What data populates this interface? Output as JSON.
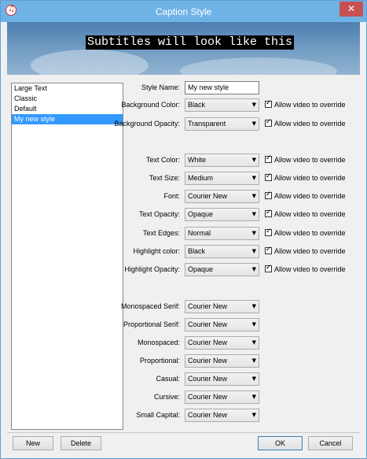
{
  "window": {
    "title": "Caption Style"
  },
  "preview": {
    "text": "Subtitles will look like this"
  },
  "styles": [
    "Large Text",
    "Classic",
    "Default",
    "My new style"
  ],
  "selected_style_index": 3,
  "form": {
    "style_name": {
      "label": "Style Name:",
      "value": "My new style"
    },
    "background_color": {
      "label": "Background Color:",
      "value": "Black",
      "override": "Allow video to override"
    },
    "background_opacity": {
      "label": "Background Opacity:",
      "value": "Transparent",
      "override": "Allow video to override"
    },
    "text_color": {
      "label": "Text Color:",
      "value": "White",
      "override": "Allow video to override"
    },
    "text_size": {
      "label": "Text Size:",
      "value": "Medium",
      "override": "Allow video to override"
    },
    "font": {
      "label": "Font:",
      "value": "Courier New",
      "override": "Allow video to override"
    },
    "text_opacity": {
      "label": "Text Opacity:",
      "value": "Opaque",
      "override": "Allow video to override"
    },
    "text_edges": {
      "label": "Text Edges:",
      "value": "Normal",
      "override": "Allow video to override"
    },
    "highlight_color": {
      "label": "Highlight color:",
      "value": "Black",
      "override": "Allow video to override"
    },
    "highlight_opacity": {
      "label": "Highlight Opacity:",
      "value": "Opaque",
      "override": "Allow video to override"
    }
  },
  "fonts": {
    "monospaced_serif": {
      "label": "Monospaced Serif:",
      "value": "Courier New"
    },
    "proportional_serif": {
      "label": "Proportional Serif:",
      "value": "Courier New"
    },
    "monospaced": {
      "label": "Monospaced:",
      "value": "Courier New"
    },
    "proportional": {
      "label": "Proportional:",
      "value": "Courier New"
    },
    "casual": {
      "label": "Casual:",
      "value": "Courier New"
    },
    "cursive": {
      "label": "Cursive:",
      "value": "Courier New"
    },
    "small_capital": {
      "label": "Small Capital:",
      "value": "Courier New"
    }
  },
  "buttons": {
    "new": "New",
    "delete": "Delete",
    "ok": "OK",
    "cancel": "Cancel"
  }
}
